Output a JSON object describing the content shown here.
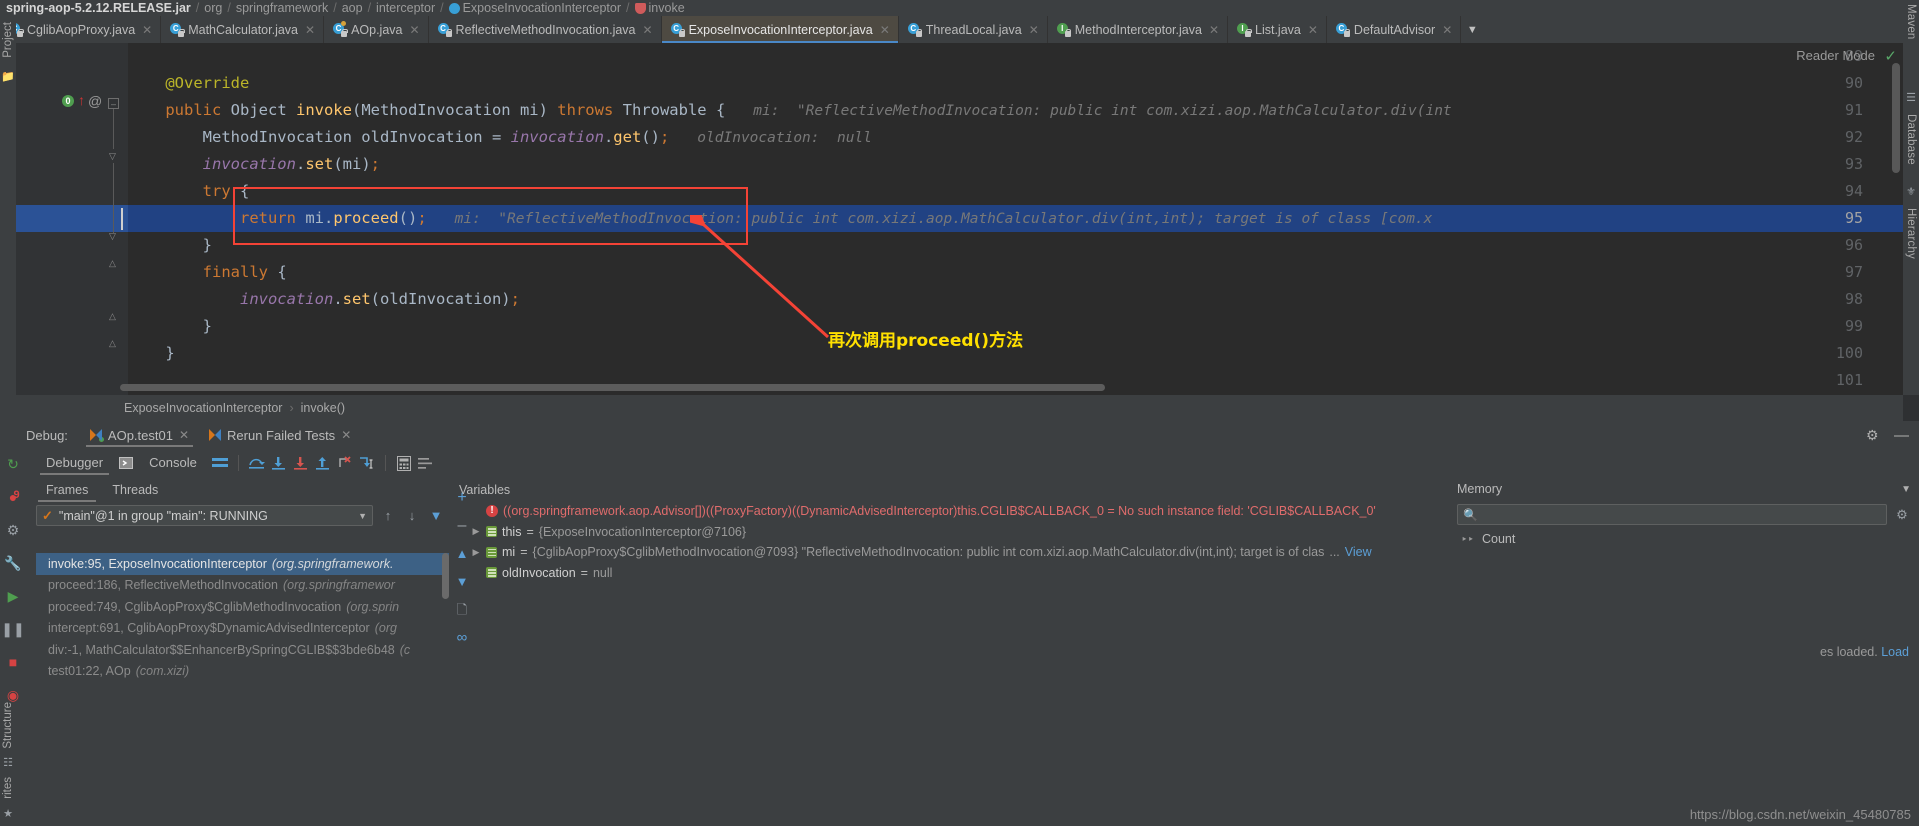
{
  "breadcrumb": {
    "root": "spring-aop-5.2.12.RELEASE.jar",
    "segments": [
      "org",
      "springframework",
      "aop",
      "interceptor"
    ],
    "class": "ExposeInvocationInterceptor",
    "method": "invoke",
    "separator": "/"
  },
  "tabs": [
    {
      "label": "CglibAopProxy.java",
      "icon": "class-icon",
      "active": false
    },
    {
      "label": "MathCalculator.java",
      "icon": "class-icon",
      "active": false
    },
    {
      "label": "AOp.java",
      "icon": "class-runnable-icon",
      "active": false
    },
    {
      "label": "ReflectiveMethodInvocation.java",
      "icon": "class-icon",
      "active": false
    },
    {
      "label": "ExposeInvocationInterceptor.java",
      "icon": "class-icon",
      "active": true
    },
    {
      "label": "ThreadLocal.java",
      "icon": "class-icon",
      "active": false
    },
    {
      "label": "MethodInterceptor.java",
      "icon": "interface-icon",
      "active": false
    },
    {
      "label": "List.java",
      "icon": "interface-icon",
      "active": false
    },
    {
      "label": "DefaultAdvisor",
      "icon": "class-icon",
      "active": false
    }
  ],
  "editor": {
    "reader_mode": "Reader Mode",
    "lines": [
      {
        "num": "89",
        "text": ""
      },
      {
        "num": "90",
        "text": "    @Override"
      },
      {
        "num": "91",
        "text": "    public Object invoke(MethodInvocation mi) throws Throwable {",
        "hint": "mi:  \"ReflectiveMethodInvocation: public int com.xizi.aop.MathCalculator.div(int"
      },
      {
        "num": "92",
        "text": "        MethodInvocation oldInvocation = invocation.get();",
        "hint": "oldInvocation:  null"
      },
      {
        "num": "93",
        "text": "        invocation.set(mi);"
      },
      {
        "num": "94",
        "text": "        try {"
      },
      {
        "num": "95",
        "text": "            return mi.proceed();",
        "hint": "mi:  \"ReflectiveMethodInvocation: public int com.xizi.aop.MathCalculator.div(int,int); target is of class [com.x",
        "selected": true
      },
      {
        "num": "96",
        "text": "        }"
      },
      {
        "num": "97",
        "text": "        finally {"
      },
      {
        "num": "98",
        "text": "            invocation.set(oldInvocation);"
      },
      {
        "num": "99",
        "text": "        }"
      },
      {
        "num": "100",
        "text": "    }"
      },
      {
        "num": "101",
        "text": ""
      }
    ],
    "annotation_note": "再次调用proceed()方法",
    "annotation_color": "#ffe000",
    "highlight_color": "#f44336"
  },
  "subcrumb": {
    "class": "ExposeInvocationInterceptor",
    "method": "invoke()",
    "separator": "›"
  },
  "debug": {
    "label": "Debug:",
    "session_tabs": [
      {
        "label": "AOp.test01",
        "active": true
      },
      {
        "label": "Rerun Failed Tests",
        "active": false
      }
    ],
    "toolbar_tabs": [
      {
        "label": "Debugger",
        "active": true
      },
      {
        "label": "Console",
        "active": false
      }
    ],
    "toolbar_icons": [
      "layout-icon",
      "step-over-icon",
      "step-into-icon",
      "force-step-into-icon",
      "step-out-icon",
      "drop-frame-icon",
      "run-to-cursor-icon",
      "evaluate-icon",
      "settings-list-icon"
    ],
    "frames_tabs": [
      {
        "label": "Frames",
        "active": true
      },
      {
        "label": "Threads",
        "active": false
      }
    ],
    "thread_selector": "\"main\"@1 in group \"main\": RUNNING",
    "frames": [
      {
        "text": "invoke:95, ExposeInvocationInterceptor",
        "pkg": "(org.springframework.",
        "selected": true
      },
      {
        "text": "proceed:186, ReflectiveMethodInvocation",
        "pkg": "(org.springframewor",
        "selected": false
      },
      {
        "text": "proceed:749, CglibAopProxy$CglibMethodInvocation",
        "pkg": "(org.sprin",
        "selected": false
      },
      {
        "text": "intercept:691, CglibAopProxy$DynamicAdvisedInterceptor",
        "pkg": "(org",
        "selected": false
      },
      {
        "text": "div:-1, MathCalculator$$EnhancerBySpringCGLIB$$3bde6b48",
        "pkg": "(c",
        "selected": false
      },
      {
        "text": "test01:22, AOp",
        "pkg": "(com.xizi)",
        "selected": false
      }
    ],
    "variables_title": "Variables",
    "variables": [
      {
        "icon": "error-icon",
        "text": "((org.springframework.aop.Advisor[])((ProxyFactory)((DynamicAdvisedInterceptor)this.CGLIB$CALLBACK_0",
        "eq": " = ",
        "value": "No such instance field: 'CGLIB$CALLBACK_0'",
        "style": "error",
        "expandable": false
      },
      {
        "icon": "object-icon",
        "name": "this",
        "eq": " = ",
        "value": "{ExposeInvocationInterceptor@7106}",
        "style": "normal",
        "expandable": true
      },
      {
        "icon": "object-icon",
        "name": "mi",
        "eq": " = ",
        "value": "{CglibAopProxy$CglibMethodInvocation@7093} \"ReflectiveMethodInvocation: public int com.xizi.aop.MathCalculator.div(int,int); target is of clas",
        "ellipsis": "...",
        "link": "View",
        "style": "normal",
        "expandable": true
      },
      {
        "icon": "object-icon",
        "name": "oldInvocation",
        "eq": " = ",
        "value": "null",
        "style": "normal",
        "expandable": false
      }
    ],
    "memory": {
      "title": "Memory",
      "search_placeholder": "",
      "count_label": "Count",
      "note": "es loaded.",
      "load_label": "Load"
    }
  },
  "rails": {
    "left_top": [
      "Project"
    ],
    "left_bottom": [
      "Structure",
      "rites"
    ],
    "right_top": [
      "Maven"
    ],
    "right_items": [
      "Database",
      "Hierarchy"
    ]
  },
  "watermark": "https://blog.csdn.net/weixin_45480785"
}
